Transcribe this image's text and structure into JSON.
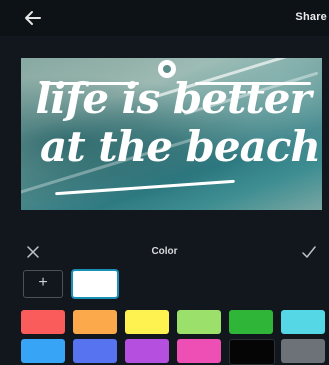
{
  "topbar": {
    "share_label": "Share",
    "back_icon": "arrow-left-icon"
  },
  "canvas": {
    "line1": "life is better",
    "line2": "at the beach"
  },
  "color_panel": {
    "title": "Color",
    "close_icon": "close-icon",
    "confirm_icon": "checkmark-icon",
    "add_label": "+",
    "current_color": "#ffffff"
  },
  "palette": {
    "row1": [
      "#fa5b5b",
      "#fca94b",
      "#fdf24f",
      "#9ae06a",
      "#2fb638",
      "#55d7e6"
    ],
    "row2": [
      "#38a4f5",
      "#5873f0",
      "#b44fe0",
      "#ee4fb4",
      "#050505",
      "#6d7279"
    ]
  }
}
